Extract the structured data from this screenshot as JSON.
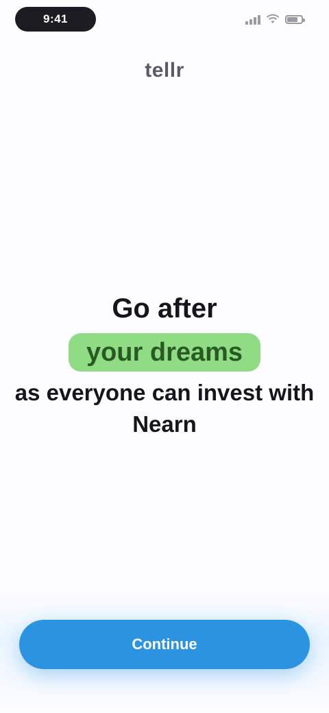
{
  "status_bar": {
    "time": "9:41",
    "icons": [
      "signal-icon",
      "wifi-icon",
      "battery-icon"
    ],
    "battery_level": 0.7
  },
  "header": {
    "title": "tellr"
  },
  "hero": {
    "line1": "Go after",
    "highlight": "your dreams",
    "line3": "as everyone can invest with Nearn"
  },
  "cta": {
    "label": "Continue"
  },
  "colors": {
    "background": "#fdfcff",
    "accent": "#2c93e0",
    "highlight": "#8fdc84",
    "text": "#15151c"
  }
}
